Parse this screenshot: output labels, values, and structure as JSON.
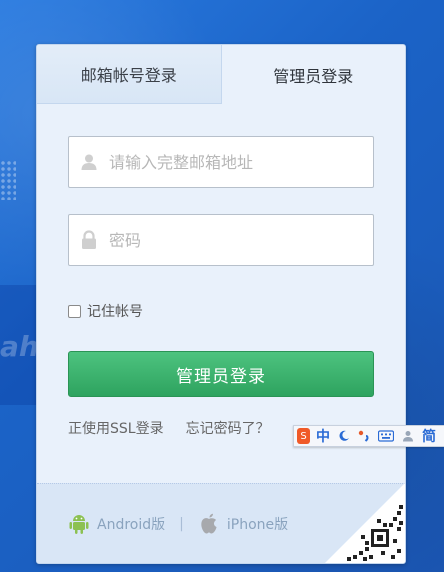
{
  "tabs": {
    "email_login": "邮箱帐号登录",
    "admin_login": "管理员登录"
  },
  "form": {
    "email_placeholder": "请输入完整邮箱地址",
    "password_placeholder": "密码",
    "remember_label": "记住帐号",
    "submit_label": "管理员登录"
  },
  "links": {
    "ssl": "正使用SSL登录",
    "forgot": "忘记密码了？"
  },
  "footer": {
    "android": "Android版",
    "separator": "|",
    "iphone": "iPhone版"
  },
  "ime": {
    "logo_text": "S",
    "lang": "中",
    "simplified": "简"
  },
  "background": {
    "partial_text": "ahi"
  },
  "colors": {
    "primary_button": "#2ea35f",
    "panel_bg": "#e9f1fb",
    "page_bg": "#1e6fd2"
  },
  "icons": {
    "user": "user-icon",
    "lock": "lock-icon",
    "android": "android-icon",
    "apple": "apple-icon",
    "qr": "qr-code-icon"
  }
}
